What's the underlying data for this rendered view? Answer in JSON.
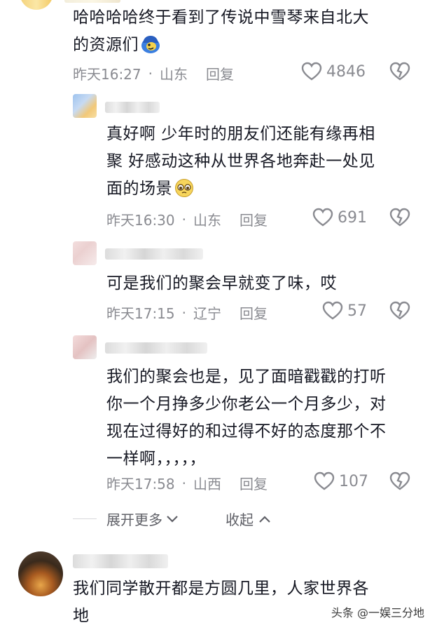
{
  "comments": [
    {
      "text_line1": "哈哈哈哈终于看到了传说中雪琴来自北大",
      "text_line2": "的资源们",
      "emoji": "emoji-blue-face-icon",
      "time": "昨天16:27",
      "location": "山东",
      "reply_label": "回复",
      "likes": "4846"
    },
    {
      "text_line1": "真好啊 少年时的朋友们还能有缘再相",
      "text_line2": "聚 好感动这种从世界各地奔赴一处见",
      "text_line3": "面的场景",
      "emoji": "emoji-teary-face-icon",
      "time": "昨天16:30",
      "location": "山东",
      "reply_label": "回复",
      "likes": "691"
    },
    {
      "text_line1": "可是我们的聚会早就变了味，哎",
      "time": "昨天17:15",
      "location": "辽宁",
      "reply_label": "回复",
      "likes": "57"
    },
    {
      "text_line1": "我们的聚会也是，见了面暗戳戳的打听",
      "text_line2": "你一个月挣多少你老公一个月多少，对",
      "text_line3": "现在过得好的和过得不好的态度那个不",
      "text_line4": "一样啊，，，，，",
      "time": "昨天17:58",
      "location": "山西",
      "reply_label": "回复",
      "likes": "107"
    },
    {
      "text_line1": "我们同学散开都是方圆几里，人家世界各",
      "text_line2": "地"
    }
  ],
  "separator": "·",
  "expand_label": "展开更多",
  "collapse_label": "收起",
  "watermark": "头条 @一娱三分地",
  "colors": {
    "text": "#161823",
    "meta": "#8a8b91",
    "background": "#ffffff"
  }
}
